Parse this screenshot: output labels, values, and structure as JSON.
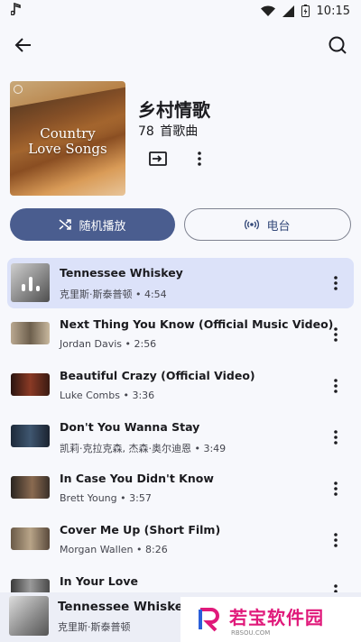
{
  "status": {
    "time": "10:15",
    "left_icon": "music-note-icon"
  },
  "topbar": {
    "back_icon": "arrow-back-icon",
    "search_icon": "search-icon"
  },
  "playlist": {
    "cover_text_line1": "Country",
    "cover_text_line2": "Love Songs",
    "title": "乡村情歌",
    "count": "78",
    "count_unit": "首歌曲"
  },
  "actions": {
    "shuffle_label": "随机播放",
    "radio_label": "电台"
  },
  "songs": [
    {
      "title": "Tennessee Whiskey",
      "artist": "克里斯·斯泰普顿",
      "duration": "4:54",
      "active": true
    },
    {
      "title": "Next Thing You Know (Official Music Video)",
      "artist": "Jordan Davis",
      "duration": "2:56"
    },
    {
      "title": "Beautiful Crazy (Official Video)",
      "artist": "Luke Combs",
      "duration": "3:36"
    },
    {
      "title": "Don't You Wanna Stay",
      "artist": "凯莉·克拉克森, 杰森·奥尔迪恩",
      "duration": "3:49"
    },
    {
      "title": "In Case You Didn't Know",
      "artist": "Brett Young",
      "duration": "3:57"
    },
    {
      "title": "Cover Me Up (Short Film)",
      "artist": "Morgan Wallen",
      "duration": "8:26"
    },
    {
      "title": "In Your Love",
      "artist": "",
      "duration": ""
    }
  ],
  "songs_sub": [
    "克里斯·斯泰普顿 • 4:54",
    "Jordan Davis • 2:56",
    "Luke Combs • 3:36",
    "凯莉·克拉克森, 杰森·奥尔迪恩 • 3:49",
    "Brett Young • 3:57",
    "Morgan Wallen • 8:26",
    ""
  ],
  "miniplayer": {
    "title": "Tennessee Whiskey",
    "artist": "克里斯·斯泰普顿"
  },
  "watermark": {
    "text": "若宝软件园",
    "url": "RBSOU.COM"
  },
  "colors": {
    "primary": "#4a5d8f",
    "active_row": "#dce2f9",
    "background": "#f7f8fc",
    "watermark": "#e0197a"
  }
}
